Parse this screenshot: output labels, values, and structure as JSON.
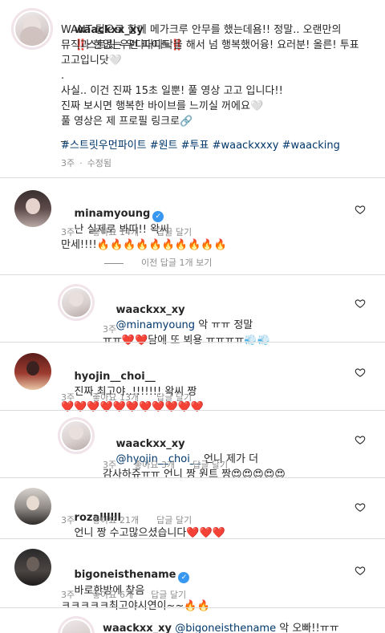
{
  "post": {
    "username": "waackxx_xy",
    "caption_line1": "‼️스트릿 우먼 파이트‼️",
    "caption_body": "WANT 팀으로 함께 메가크루 안무를 했는데욤!! 정말.. 오랜만의\n뮤직과 한없는 우다다다닥을 해서 넘 행복했어융! 요러분! 올른! 투표\n고고입니닷🤍\n.\n사실.. 이건 진짜 15초 일뿐! 풀 영상 고고 입니다!!\n진짜 보시면 행복한 바이브를 느끼실 꺼에요🤍\n풀 영상은 제 프로필 링크로🔗\n_",
    "hashtags": "#스트릿우먼파이트 #원트 #투표 #waackxxxy #waacking",
    "time": "3주",
    "edited": "수정됨"
  },
  "comments": [
    {
      "username": "minamyoung",
      "verified": true,
      "text": "난 실제로 봐따!! 왁씨\n만세!!!!🔥🔥🔥🔥🔥🔥🔥🔥🔥🔥",
      "time": "3주",
      "likes": "좋아요 14개",
      "reply": "답글 달기"
    },
    {
      "username": "hyojin__choi__",
      "verified": false,
      "text": "진짜 최고야..!!!!!!! 왁씨 짱\n❤️❤️❤️❤️❤️❤️❤️❤️❤️❤️❤️",
      "time": "3주",
      "likes": "좋아요 13개",
      "reply": "답글 달기"
    },
    {
      "username": "rozallllll",
      "verified": false,
      "text": "언니 짱 수고많으셨습니다❤️❤️❤️",
      "time": "3주",
      "likes": "좋아요 21개",
      "reply": "답글 달기"
    },
    {
      "username": "bigoneisthename",
      "verified": true,
      "text": "바로한방에 찾음\nㅋㅋㅋㅋㅋ최고야시연이~~🔥🔥",
      "time": "3주",
      "likes": "좋아요 6개",
      "reply": "답글 달기"
    }
  ],
  "view_replies": "이전 답글 1개 보기",
  "replies": [
    {
      "username": "waackxx_xy",
      "mention": "@minamyoung",
      "text": " 악 ㅠㅠ 정말\nㅠㅠ❤️❤️담에 또 뵈용 ㅠㅠㅠㅠ💨💨",
      "time": "3주",
      "likes": "",
      "reply": ""
    },
    {
      "username": "waackxx_xy",
      "mention": "@hyojin__choi__",
      "text": " 언니 제가 더\n감사하쥬ㅠㅠ 언니 짱 원트 짱😍😍😍😍😍",
      "time": "3주",
      "likes": "좋아요 3개",
      "reply": "답글 달기"
    },
    {
      "username": "waackxx_xy",
      "mention": "@bigoneisthename",
      "text": " 악 오빠!!ㅠㅠ",
      "time": "",
      "likes": "",
      "reply": ""
    }
  ],
  "colors": {
    "text": "#262626",
    "meta": "#8e8e8e",
    "link": "#00376b",
    "verified": "#3897f0",
    "divider": "#dbdbdb"
  },
  "icons": {
    "like": "heart-outline-icon",
    "verified": "verified-badge-icon"
  }
}
